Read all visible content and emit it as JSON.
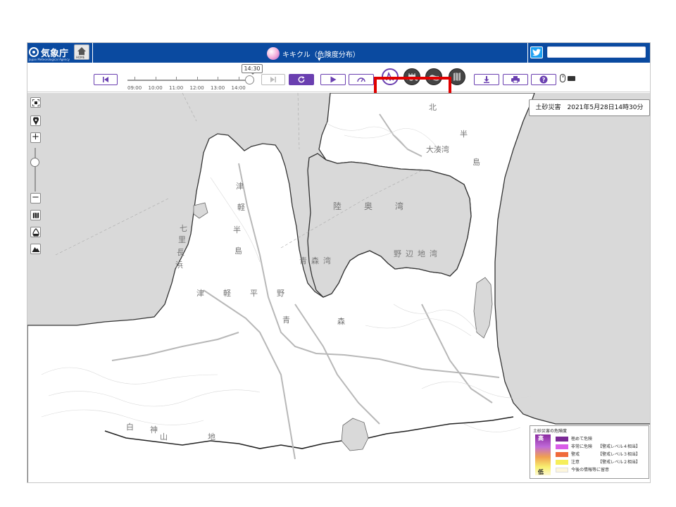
{
  "header": {
    "agency_name": "気象庁",
    "agency_name_en": "Japan Meteorological Agency",
    "home_label": "HOME",
    "title": "キキクル（危険度分布）",
    "search_placeholder": ""
  },
  "toolbar": {
    "current_time": "14:30",
    "time_ticks": [
      "09:00",
      "10:00",
      "11:00",
      "12:00",
      "13:00",
      "14:00"
    ],
    "slider_position_fraction": 0.96
  },
  "icons": {
    "rewind": "skip-back-icon",
    "forward": "skip-forward-icon",
    "refresh": "refresh-icon",
    "play": "play-icon",
    "speed": "speed-gauge-icon",
    "hazard": "landslide-hazard-icon",
    "flood": "flood-hazard-icon",
    "inundation": "inundation-hazard-icon",
    "map": "map-icon",
    "download": "download-icon",
    "print": "print-icon",
    "help": "help-icon"
  },
  "map": {
    "timestamp": "土砂災害　2021年5月28日14時30分",
    "labels": {
      "kita": "北",
      "han": "半",
      "shima": "島",
      "ominato": "大湊湾",
      "mutsu_bay": "陸　奥　湾",
      "noheji_bay": "野辺地湾",
      "aomori_bay": "青森湾",
      "tsu": "津",
      "karu": "軽",
      "han2": "半",
      "shima2": "島",
      "shichiri": "七",
      "ri": "里",
      "naga": "長",
      "hama": "浜",
      "tsugaru_plain": "津　軽　平　野",
      "ao": "青",
      "mori": "森",
      "shiro": "白",
      "kami": "神",
      "yama": "山",
      "chi": "地"
    }
  },
  "legend": {
    "title": "土砂災害の危険度",
    "high": "高",
    "low": "低",
    "items": [
      {
        "label": "極めて危険",
        "level": "",
        "color": "#7b2a96"
      },
      {
        "label": "非常に危険",
        "level": "【警戒レベル４相当】",
        "color": "#d95de8"
      },
      {
        "label": "警戒",
        "level": "【警戒レベル３相当】",
        "color": "#f06a3a"
      },
      {
        "label": "注意",
        "level": "【警戒レベル２相当】",
        "color": "#f6ee5a"
      },
      {
        "label": "今後の情報等に留意",
        "level": "",
        "color": "#fdf6dc"
      }
    ]
  },
  "colors": {
    "header_bg": "#0a4aa0",
    "accent": "#6a3fb0",
    "highlight": "#e00000",
    "sea": "#d9d9d9",
    "land": "#ffffff"
  }
}
